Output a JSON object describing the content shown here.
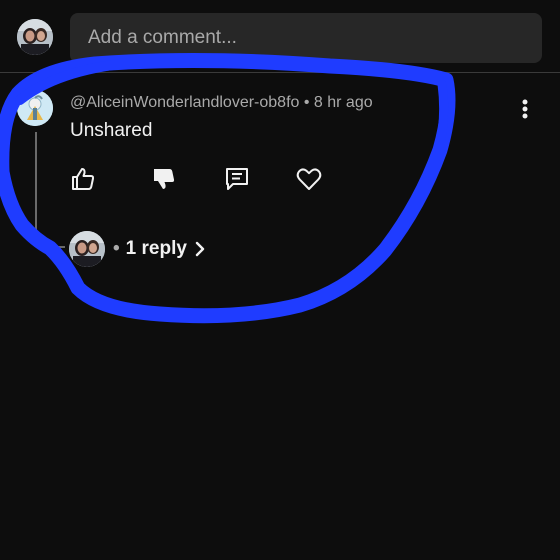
{
  "comment_bar": {
    "placeholder": "Add a comment..."
  },
  "comment": {
    "author_handle": "@AliceinWonderlandlover-ob8fo",
    "separator": " • ",
    "time_ago": "8 hr ago",
    "text": "Unshared",
    "replies_label": "1 reply"
  },
  "icons": {
    "more": "more-vertical-icon",
    "like": "thumbs-up-icon",
    "dislike": "thumbs-down-icon",
    "reply": "comment-icon",
    "heart": "heart-icon",
    "chevron": "chevron-right-icon"
  },
  "colors": {
    "background": "#0d0d0d",
    "input_background": "#272727",
    "annotation_blue": "#1f3cff"
  }
}
